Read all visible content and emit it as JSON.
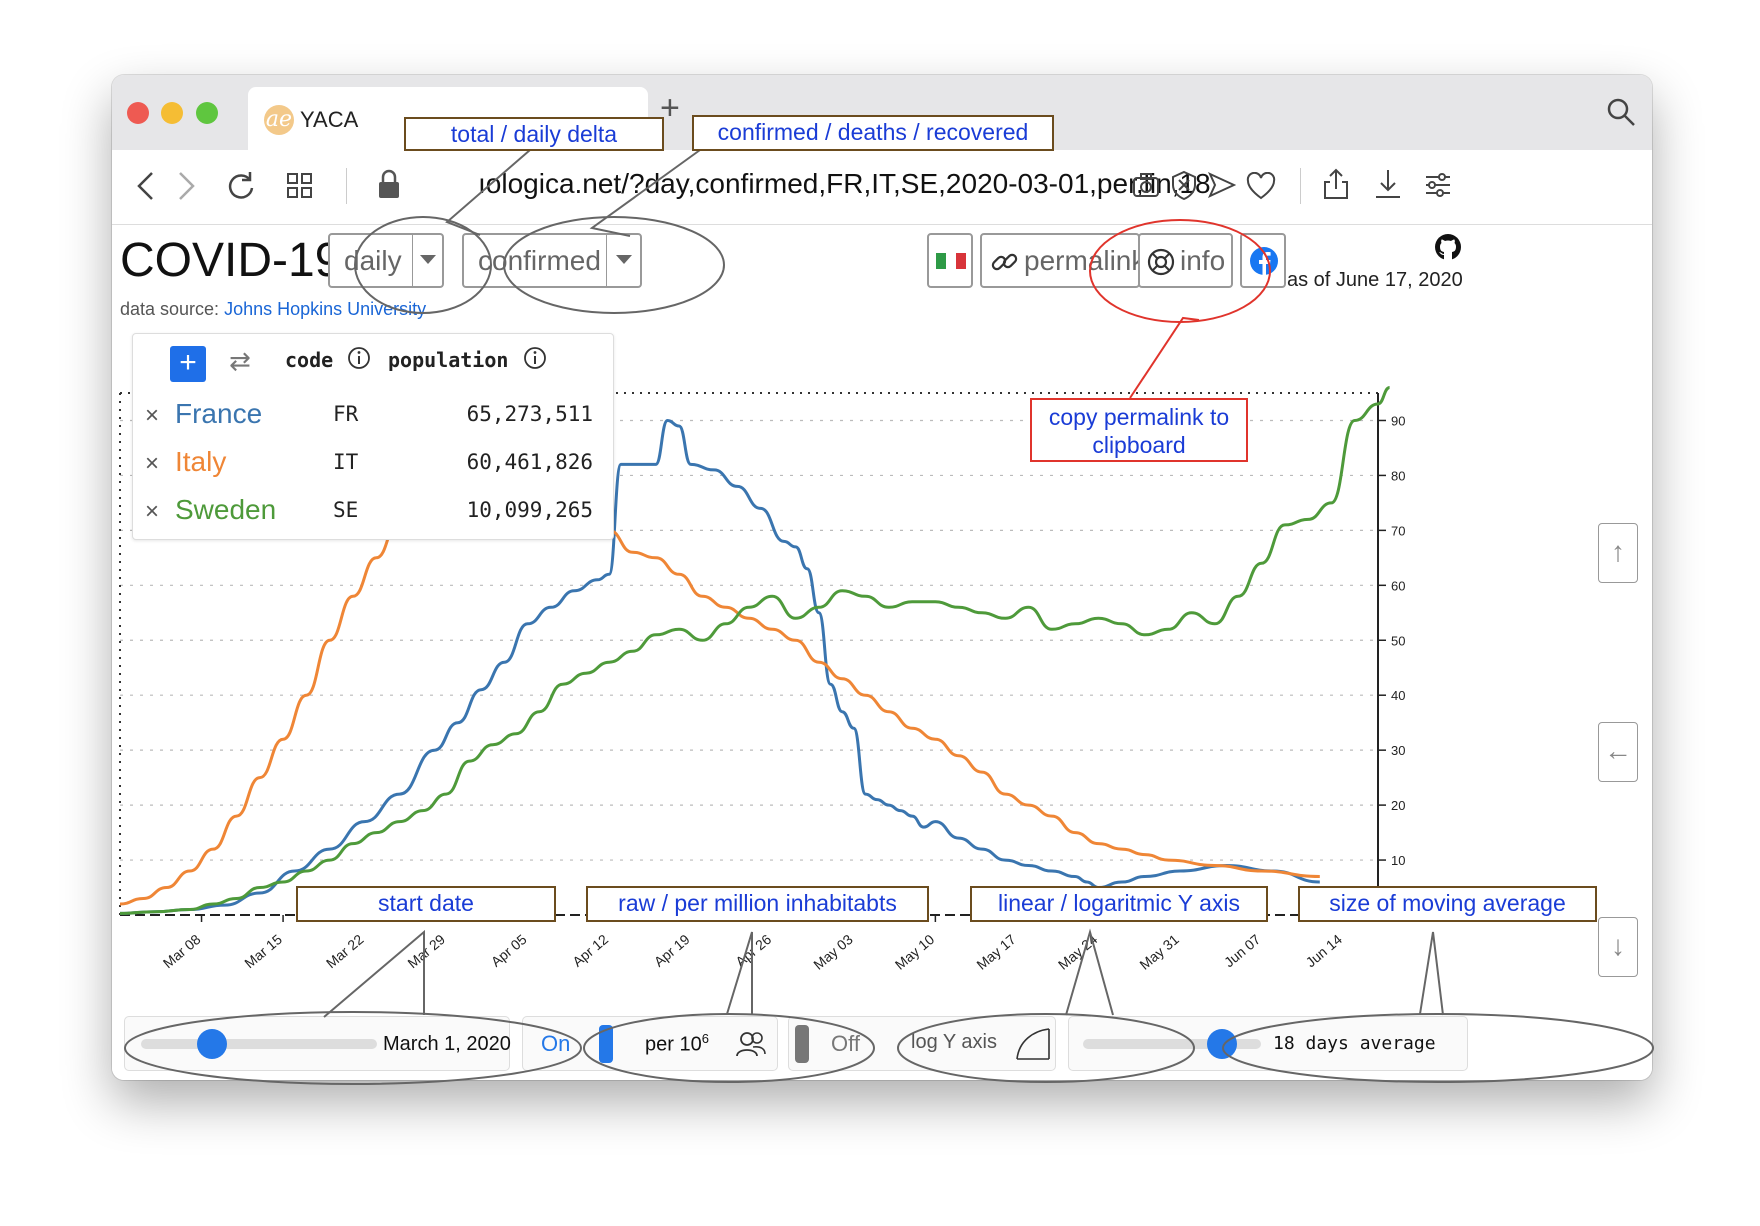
{
  "browser": {
    "tab_title": "YACA",
    "tab_icon": "ae",
    "new_tab": "+",
    "url": "ıologica.net/?day,confirmed,FR,IT,SE,2020-03-01,per,lin,18"
  },
  "app": {
    "title": "COVID-19",
    "mode_select": "daily",
    "metric_select": "confirmed",
    "permalink_label": "permalink",
    "info_label": "info",
    "as_of": "as of June 17, 2020",
    "data_source_label": "data source:",
    "data_source_link": "Johns Hopkins University"
  },
  "legend": {
    "code_header": "code",
    "population_header": "population",
    "rows": [
      {
        "name": "France",
        "code": "FR",
        "population": "65,273,511",
        "color": "#3a75af"
      },
      {
        "name": "Italy",
        "code": "IT",
        "population": "60,461,826",
        "color": "#ef8636"
      },
      {
        "name": "Sweden",
        "code": "SE",
        "population": "10,099,265",
        "color": "#4e9a3a"
      }
    ]
  },
  "annotations": {
    "total_daily": "total / daily delta",
    "confirmed_deaths": "confirmed / deaths / recovered",
    "copy_permalink_1": "copy permalink to",
    "copy_permalink_2": "clipboard",
    "start_date": "start date",
    "raw_per_million": "raw / per million inhabitabts",
    "linear_log": "linear / logaritmic Y axis",
    "moving_avg": "size of moving average"
  },
  "controls": {
    "start_date_value": "March 1, 2020",
    "start_slider_fraction": 0.3,
    "per_on": "On",
    "per_label_base": "per 10",
    "per_label_exp": "6",
    "log_off": "Off",
    "log_label": "log Y axis",
    "avg_label": "18 days average",
    "avg_slider_fraction": 0.78
  },
  "chart_data": {
    "type": "line",
    "ylim": [
      0,
      95
    ],
    "yticks": [
      0,
      10,
      20,
      30,
      40,
      50,
      60,
      70,
      80,
      90
    ],
    "xlim": [
      0,
      108
    ],
    "xticks": [
      {
        "x": 7,
        "label": "Mar 08"
      },
      {
        "x": 14,
        "label": "Mar 15"
      },
      {
        "x": 21,
        "label": "Mar 22"
      },
      {
        "x": 28,
        "label": "Mar 29"
      },
      {
        "x": 35,
        "label": "Apr 05"
      },
      {
        "x": 42,
        "label": "Apr 12"
      },
      {
        "x": 49,
        "label": "Apr 19"
      },
      {
        "x": 56,
        "label": "Apr 26"
      },
      {
        "x": 63,
        "label": "May 03"
      },
      {
        "x": 70,
        "label": "May 10"
      },
      {
        "x": 77,
        "label": "May 17"
      },
      {
        "x": 84,
        "label": "May 24"
      },
      {
        "x": 91,
        "label": "May 31"
      },
      {
        "x": 98,
        "label": "Jun 07"
      },
      {
        "x": 105,
        "label": "Jun 14"
      }
    ],
    "grid": true,
    "series": [
      {
        "name": "France",
        "color": "#3a75af",
        "points": [
          [
            0,
            0.3
          ],
          [
            3,
            0.6
          ],
          [
            6,
            1
          ],
          [
            9,
            1.8
          ],
          [
            12,
            4
          ],
          [
            15,
            8
          ],
          [
            18,
            12
          ],
          [
            21,
            17
          ],
          [
            24,
            22
          ],
          [
            27,
            30
          ],
          [
            29,
            35
          ],
          [
            31,
            41
          ],
          [
            33,
            46
          ],
          [
            35,
            53
          ],
          [
            37,
            56
          ],
          [
            39,
            59
          ],
          [
            41,
            61
          ],
          [
            42,
            62
          ],
          [
            43,
            82
          ],
          [
            45,
            82
          ],
          [
            46,
            82
          ],
          [
            47,
            90
          ],
          [
            48,
            89
          ],
          [
            49,
            82
          ],
          [
            51,
            81
          ],
          [
            53,
            78
          ],
          [
            55,
            74
          ],
          [
            57,
            68
          ],
          [
            58,
            67
          ],
          [
            59,
            63
          ],
          [
            60,
            55
          ],
          [
            61,
            42
          ],
          [
            62,
            37
          ],
          [
            63,
            34
          ],
          [
            64,
            22
          ],
          [
            65,
            21
          ],
          [
            66,
            20
          ],
          [
            67,
            19
          ],
          [
            68,
            18
          ],
          [
            69,
            16
          ],
          [
            70,
            17
          ],
          [
            72,
            14
          ],
          [
            74,
            12
          ],
          [
            76,
            10
          ],
          [
            78,
            9
          ],
          [
            80,
            8
          ],
          [
            82,
            7
          ],
          [
            83,
            6
          ],
          [
            84,
            5
          ],
          [
            86,
            6
          ],
          [
            88,
            7
          ],
          [
            91,
            8
          ],
          [
            95,
            9
          ],
          [
            99,
            8
          ],
          [
            103,
            6
          ]
        ]
      },
      {
        "name": "Italy",
        "color": "#ef8636",
        "points": [
          [
            0,
            2
          ],
          [
            2,
            3
          ],
          [
            4,
            5
          ],
          [
            6,
            8
          ],
          [
            8,
            12
          ],
          [
            10,
            18
          ],
          [
            12,
            25
          ],
          [
            14,
            32
          ],
          [
            16,
            40
          ],
          [
            18,
            50
          ],
          [
            20,
            58
          ],
          [
            22,
            65
          ],
          [
            24,
            72
          ],
          [
            26,
            78
          ],
          [
            28,
            82
          ],
          [
            30,
            84
          ],
          [
            32,
            84
          ],
          [
            34,
            82
          ],
          [
            36,
            79
          ],
          [
            38,
            78
          ],
          [
            40,
            77
          ],
          [
            42,
            70
          ],
          [
            44,
            66
          ],
          [
            46,
            65
          ],
          [
            48,
            62
          ],
          [
            50,
            58
          ],
          [
            52,
            56
          ],
          [
            54,
            54
          ],
          [
            56,
            52
          ],
          [
            58,
            50
          ],
          [
            60,
            46
          ],
          [
            62,
            43
          ],
          [
            64,
            40
          ],
          [
            66,
            37
          ],
          [
            68,
            34
          ],
          [
            70,
            32
          ],
          [
            72,
            29
          ],
          [
            74,
            26
          ],
          [
            76,
            22
          ],
          [
            78,
            20
          ],
          [
            80,
            18
          ],
          [
            82,
            15
          ],
          [
            84,
            13
          ],
          [
            86,
            12
          ],
          [
            88,
            11
          ],
          [
            90,
            10
          ],
          [
            94,
            9
          ],
          [
            98,
            8
          ],
          [
            103,
            7
          ]
        ]
      },
      {
        "name": "Sweden",
        "color": "#4e9a3a",
        "points": [
          [
            0,
            0.3
          ],
          [
            3,
            0.6
          ],
          [
            6,
            1
          ],
          [
            8,
            2
          ],
          [
            10,
            3
          ],
          [
            12,
            5
          ],
          [
            14,
            6
          ],
          [
            16,
            8
          ],
          [
            18,
            10
          ],
          [
            20,
            13
          ],
          [
            22,
            15
          ],
          [
            24,
            17
          ],
          [
            26,
            19
          ],
          [
            28,
            22
          ],
          [
            30,
            28
          ],
          [
            32,
            31
          ],
          [
            34,
            33
          ],
          [
            36,
            37
          ],
          [
            38,
            42
          ],
          [
            40,
            44
          ],
          [
            42,
            46
          ],
          [
            44,
            48
          ],
          [
            46,
            51
          ],
          [
            48,
            52
          ],
          [
            50,
            50
          ],
          [
            52,
            53
          ],
          [
            54,
            56
          ],
          [
            56,
            58
          ],
          [
            58,
            54
          ],
          [
            60,
            56
          ],
          [
            62,
            59
          ],
          [
            64,
            58
          ],
          [
            66,
            56
          ],
          [
            68,
            57
          ],
          [
            70,
            57
          ],
          [
            72,
            56
          ],
          [
            74,
            55
          ],
          [
            76,
            54
          ],
          [
            78,
            56
          ],
          [
            80,
            52
          ],
          [
            82,
            53
          ],
          [
            84,
            54
          ],
          [
            86,
            53
          ],
          [
            88,
            51
          ],
          [
            90,
            52
          ],
          [
            92,
            55
          ],
          [
            94,
            53
          ],
          [
            96,
            58
          ],
          [
            98,
            64
          ],
          [
            100,
            71
          ],
          [
            102,
            72
          ],
          [
            104,
            75
          ],
          [
            106,
            90
          ],
          [
            108,
            93
          ],
          [
            109,
            96
          ]
        ]
      }
    ]
  }
}
